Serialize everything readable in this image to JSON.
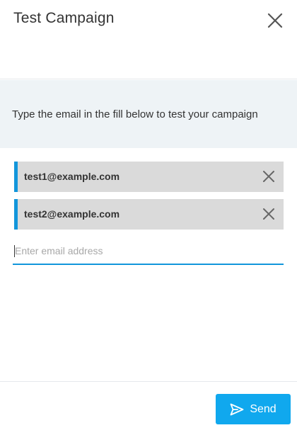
{
  "dialog": {
    "title": "Test Campaign",
    "close_icon": "close-icon"
  },
  "info": {
    "text": "Type the email in the fill below to test your campaign"
  },
  "recipients": [
    {
      "email": "test1@example.com",
      "remove_icon": "close-icon"
    },
    {
      "email": "test2@example.com",
      "remove_icon": "close-icon"
    }
  ],
  "email_input": {
    "value": "",
    "placeholder": "Enter email address"
  },
  "footer": {
    "send_label": "Send",
    "send_icon": "send-icon"
  },
  "colors": {
    "accent": "#1296db",
    "send_button": "#10a8ee",
    "info_background": "#eef3f6",
    "chip_background": "#dadada"
  }
}
